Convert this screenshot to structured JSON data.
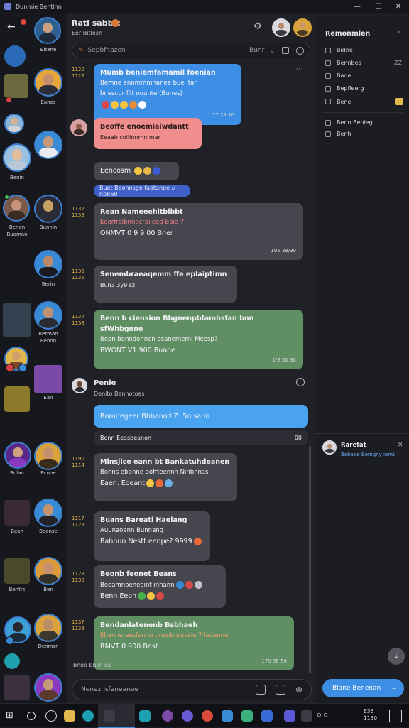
{
  "window": {
    "title": "Dunmie Bentinn",
    "minimize": "—",
    "maximize": "☐",
    "close": "✕"
  },
  "contacts": [
    {
      "name": "Bitene"
    },
    {
      "name": "Eanos"
    },
    {
      "name": ""
    },
    {
      "name": "Benin"
    },
    {
      "name": "Benen"
    },
    {
      "name": "Bunnin"
    },
    {
      "name": "Buaman"
    },
    {
      "name": "Berin"
    },
    {
      "name": "Berman"
    },
    {
      "name": "Benon"
    },
    {
      "name": "Ean"
    },
    {
      "name": "Bolan"
    },
    {
      "name": "Ecune"
    },
    {
      "name": "Bean"
    },
    {
      "name": "Beanse"
    },
    {
      "name": "Bentrs"
    },
    {
      "name": "Ben"
    },
    {
      "name": "Denmsn"
    }
  ],
  "chat": {
    "name": "Rati sabbic",
    "status": "Eer Bitlesn",
    "search_placeholder": "Sepbfnazen",
    "search_filter": "Bunr",
    "messages": [
      {
        "time": "1120\n1127",
        "lines": [
          "Mumb beniemfamamil foenian",
          "Bemne ennmmmnanee bue ltan",
          "bnescur filt nounte (Bunes)"
        ],
        "stamp": "77   25 10"
      },
      {
        "lines": [
          "Beoffe enoemiaiwdantt"
        ],
        "sub": "Eeaab coilinnmn mar"
      },
      {
        "lines": [
          "Eencosm"
        ]
      },
      {
        "tag": "Buet Beonnsge faotanpe // hp860"
      },
      {
        "time": "1132\n1133",
        "lines": [
          "Rean Nameeehltbibbt",
          "Eeorfrolbnnbcraiieed Baie 7",
          "ONMVT 0 9 9 00 Bner"
        ],
        "stamp": "195   39/30"
      },
      {
        "time": "1135\n1136",
        "lines": [
          "Senembraeaqemm ffe eplaiptimn",
          "Bun3 3y9 sz"
        ]
      },
      {
        "time": "1137\n1138",
        "lines": [
          "Benn b ciension   Bbgnenpbfamhsfan bnn sfWhbgene",
          "Bean benndonnen osanemerni Meesp?",
          "BWONT V1 900 Buane"
        ],
        "stamp": "1/8   50  30"
      },
      {
        "sender": "Penie",
        "sender_sub": "Denito Bennotoas"
      },
      {
        "lines": [
          "Bnmnegeer Bhbanod Z: 5o:sann"
        ]
      },
      {
        "lines": [
          "Bonn Eeasbeanon"
        ],
        "stamp": "00"
      },
      {
        "time": "1190\n1114",
        "lines": [
          "Minsjice eann bt Bankatuhdeanen",
          "Bonns ebbnne eoffteennn Ninbnnas",
          "Eaen. Eoeant"
        ]
      },
      {
        "time": "1117\n1128",
        "lines": [
          "Buans Bareati Haeiang",
          "Auunaoann Bunnang",
          "Bahnun Nestt eenpe?   9999"
        ]
      },
      {
        "time": "1128\n1130",
        "lines": [
          "Beonb feonet Beans",
          "Beeamnbeneeint innann",
          "Benn Eeon"
        ]
      },
      {
        "time": "1137\n1138",
        "lines": [
          "Bendanlatenenb Bsbhaeh",
          "Ebannereesfannn dnenbnraasie 7 ledanner",
          "RMVT 0 900 Bnst"
        ],
        "stamp": "179   85  50"
      }
    ],
    "footer_status": "bnoo   bnsr Ba",
    "composer_placeholder": "Nenezhsfaneanee"
  },
  "panel": {
    "title": "Remonmlen",
    "items": [
      {
        "label": "Bidne"
      },
      {
        "label": "Bennbes",
        "badge": "ZZ"
      },
      {
        "label": "Bade"
      },
      {
        "label": "Bepfleerg"
      },
      {
        "label": "Bene"
      }
    ],
    "items2": [
      {
        "label": "Benn Benieg"
      },
      {
        "label": "Benh"
      }
    ],
    "notify_name": "Rarefat",
    "notify_text": "Bebabe Bemgny iemt",
    "send_label": "Blane Benenan"
  },
  "taskbar": {
    "clock": "E36\n1150"
  },
  "colors": {
    "accent": "#3d8fe6",
    "green": "#5f8f63",
    "pink": "#f08d8d",
    "gold": "#e2b84a"
  }
}
